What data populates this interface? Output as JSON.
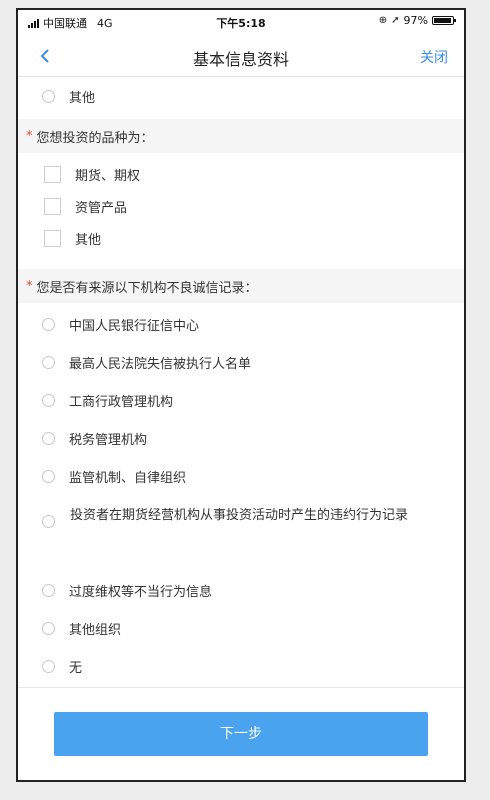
{
  "status_bar": {
    "carrier": "中国联通",
    "network": "4G",
    "time": "下午5:18",
    "battery": "97%",
    "battery_level": 0.97
  },
  "nav": {
    "title": "基本信息资料",
    "close_label": "关闭",
    "back_icon": "chevron-left-icon"
  },
  "top_option": "其他",
  "q_investment": {
    "title": "您想投资的品种为：",
    "options": [
      "期货、期权",
      "资管产品",
      "其他"
    ]
  },
  "q_integrity": {
    "title": "您是否有来源以下机构不良诚信记录：",
    "options": [
      "中国人民银行征信中心",
      "最高人民法院失信被执行人名单",
      "工商行政管理机构",
      "税务管理机构",
      "监管机制、自律组织",
      "投资者在期货经营机构从事投资活动时产生的违约行为记录",
      "过度维权等不当行为信息",
      "其他组织",
      "无"
    ]
  },
  "footer": {
    "next_label": "下一步"
  },
  "colors": {
    "accent": "#3a8ee6",
    "button": "#4aa3ee",
    "required": "#e0493b"
  }
}
